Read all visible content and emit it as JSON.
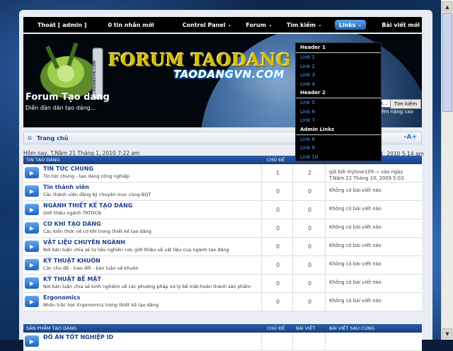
{
  "nav": {
    "items": [
      {
        "label": "Thoát [ admin ]",
        "chev": ""
      },
      {
        "label": "0 tin nhắn mới",
        "chev": ""
      },
      {
        "label": "Control Panel",
        "chev": "⌄"
      },
      {
        "label": "Forum",
        "chev": "⌄"
      },
      {
        "label": "Tìm kiếm",
        "chev": "⌄"
      },
      {
        "label": "Links",
        "chev": "⌄"
      },
      {
        "label": "Bài viết mới",
        "chev": ""
      }
    ]
  },
  "dropdown": {
    "header1": "Header 1",
    "links1": [
      "Link 1",
      "Link 2",
      "Link 3",
      "Link 4"
    ],
    "header2": "Header 2",
    "links2": [
      "Link 5",
      "Link 6",
      "Link 7"
    ],
    "header3": "Admin Links",
    "links3": [
      "Link 8",
      "Link 9",
      "Link 10"
    ]
  },
  "banner": {
    "logo_text": "FORUM TAODANG",
    "logo_sub": "TAODANGVN.COM",
    "logo_side": "TAODANGVN.COM",
    "forum_title": "Forum Tạo dáng",
    "forum_desc": "Diễn đàn dân tạo dáng...",
    "search_placeholder": "Từ khóa...",
    "search_button": "Tìm kiếm",
    "advanced_search": "Tìm kiếm nâng cao"
  },
  "breadcrumb": {
    "home": "Trang chủ",
    "collapse": "-A+"
  },
  "now_text": "Hôm nay, T.Năm 21 Tháng 1, 2010 7:22 am",
  "last_visit": "Tháng 1, 2010 5:14 am",
  "categories": [
    {
      "name": "TIN TẠO DÁNG",
      "col_topics": "CHỦ ĐỀ",
      "col_posts": "BÀI VIẾT",
      "col_last": "BÀI VIẾT SAU CÙNG",
      "forums": [
        {
          "name": "TIN TỨC CHUNG",
          "desc": "Tin tức chung - tạo dáng công nghiệp",
          "topics": "1",
          "posts": "2",
          "last": "gửi bởi mylove109 ⇨ vào ngày T.Năm 22 Tháng 10, 2009 5:03 am"
        },
        {
          "name": "Tin thành viên",
          "desc": "Các thành viên đăng ký chuyên mục cùng BQT",
          "topics": "0",
          "posts": "0",
          "last": "Không có bài viết nào"
        },
        {
          "name": "NGÀNH THIẾT KẾ TẠO DÁNG",
          "desc": "Giới thiệu ngành TKTDCN",
          "topics": "0",
          "posts": "0",
          "last": "Không có bài viết nào"
        },
        {
          "name": "CƠ KHÍ TẠO DÁNG",
          "desc": "Các kiến thức về cơ khí trong thiết kế tạo dáng",
          "topics": "0",
          "posts": "0",
          "last": "Không có bài viết nào"
        },
        {
          "name": "VẬT LIỆU CHUYÊN NGÀNH",
          "desc": "Nơi bàn luận chia sẻ tư liệu nghiên cứu giới thiệu về vật liệu của ngành tạo dáng",
          "topics": "0",
          "posts": "0",
          "last": "Không có bài viết nào"
        },
        {
          "name": "KỸ THUẬT KHUÔN",
          "desc": "Các chủ đề - trao đổi - bàn luận về khuôn",
          "topics": "0",
          "posts": "0",
          "last": "Không có bài viết nào"
        },
        {
          "name": "KỸ THUẬT BỀ MẶT",
          "desc": "Nơi bàn luận chia sẻ kinh nghiệm về các phương pháp xử lý bề mặt-hoàn thành sản phẩm",
          "topics": "0",
          "posts": "0",
          "last": "Không có bài viết nào"
        },
        {
          "name": "Ergonomics",
          "desc": "Nhân trắc học Ergonomics trong thiết kế tạo dáng",
          "topics": "0",
          "posts": "0",
          "last": "Không có bài viết nào"
        }
      ]
    },
    {
      "name": "SẢN PHẨM TẠO DÁNG",
      "col_topics": "CHỦ ĐỀ",
      "col_posts": "BÀI VIẾT",
      "col_last": "BÀI VIẾT SAU CÙNG",
      "forums": [
        {
          "name": "ĐỒ ÁN TỐT NGHIỆP ID",
          "desc": "",
          "topics": "",
          "posts": "",
          "last": ""
        }
      ]
    }
  ]
}
